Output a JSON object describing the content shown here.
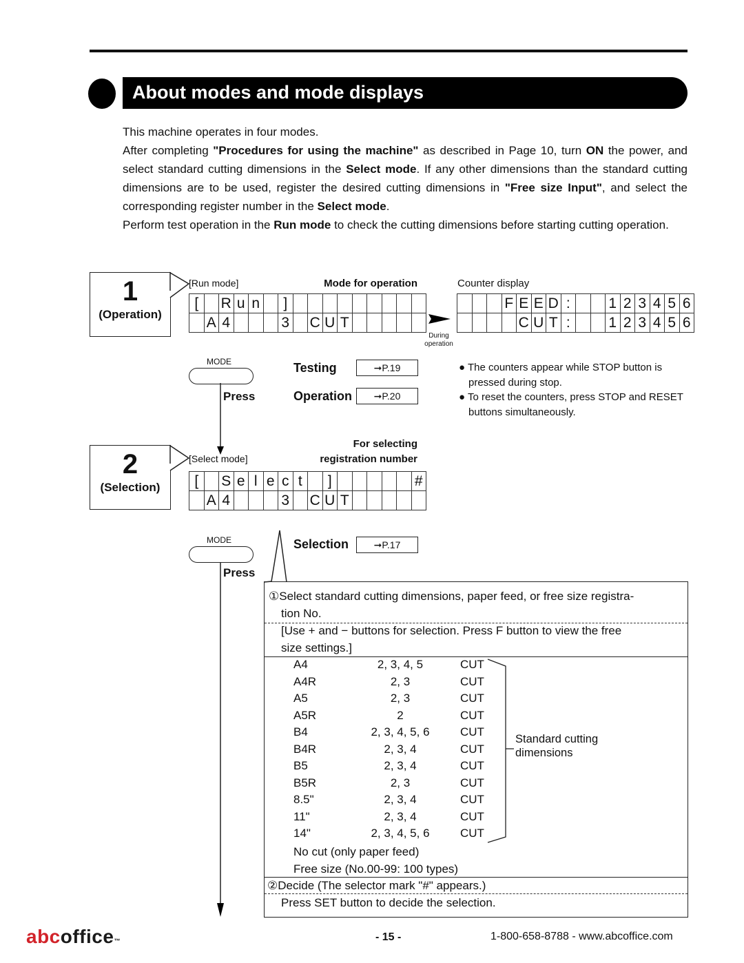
{
  "header": {
    "title": "About modes and mode displays"
  },
  "intro": {
    "p1": "This machine operates in four modes.",
    "p2_a": "After completing ",
    "p2_b": "\"Procedures for using the machine\"",
    "p2_c": " as described in Page 10, turn ",
    "p2_d": "ON",
    "p2_e": " the power, and select standard cutting dimensions in the ",
    "p2_f": "Select mode",
    "p2_g": ". If any other dimensions than the standard cutting dimensions are to be used, register the desired cutting dimensions in ",
    "p2_h": "\"Free size Input\"",
    "p2_i": ", and select the corresponding register number in the ",
    "p2_j": "Select mode",
    "p2_k": ".",
    "p3_a": "Perform test operation in the ",
    "p3_b": "Run mode",
    "p3_c": " to check the cutting dimensions before starting cutting operation."
  },
  "step1": {
    "number": "1",
    "label": "(Operation)",
    "mode_label": "[Run mode]",
    "mode_desc": "Mode for operation",
    "lcd_row1": [
      "[",
      "",
      "R",
      "u",
      "n",
      "",
      "]",
      "",
      "",
      "",
      "",
      "",
      "",
      "",
      "",
      ""
    ],
    "lcd_row2": [
      "",
      "A",
      "4",
      "",
      "",
      "",
      "3",
      "",
      "C",
      "U",
      "T",
      "",
      "",
      "",
      "",
      ""
    ],
    "during_label_1": "During",
    "during_label_2": "operation",
    "counter_title": "Counter display",
    "counter_row1": [
      "",
      "",
      "",
      "F",
      "E",
      "E",
      "D",
      ":",
      "",
      "",
      "1",
      "2",
      "3",
      "4",
      "5",
      "6"
    ],
    "counter_row2": [
      "",
      "",
      "",
      "",
      "C",
      "U",
      "T",
      ":",
      "",
      "",
      "1",
      "2",
      "3",
      "4",
      "5",
      "6"
    ],
    "mode_button_caption": "MODE",
    "press_label": "Press",
    "refs": [
      {
        "label": "Testing",
        "page": "➞P.19"
      },
      {
        "label": "Operation",
        "page": "➞P.20"
      }
    ],
    "notes": [
      "● The counters appear while STOP button is pressed during stop.",
      "● To reset the counters, press STOP and RESET buttons simultaneously."
    ]
  },
  "step2": {
    "number": "2",
    "label": "(Selection)",
    "mode_label": "[Select mode]",
    "mode_desc_1": "For selecting",
    "mode_desc_2": "registration number",
    "lcd_row1": [
      "[",
      "",
      "S",
      "e",
      "l",
      "e",
      "c",
      "t",
      "",
      "]",
      "",
      "",
      "",
      "",
      "",
      "#"
    ],
    "lcd_row2": [
      "",
      "A",
      "4",
      "",
      "",
      "",
      "3",
      "",
      "C",
      "U",
      "T",
      "",
      "",
      "",
      "",
      ""
    ],
    "mode_button_caption": "MODE",
    "press_label": "Press",
    "ref": {
      "label": "Selection",
      "page": "➞P.17"
    }
  },
  "procedure": {
    "step1_line1": "①Select standard cutting dimensions, paper feed, or free size registra-",
    "step1_line2": "tion No.",
    "hint_line1": "[Use  +  and  −  buttons for selection. Press F button to view the free",
    "hint_line2": "size settings.]",
    "sizes": [
      {
        "size": "A4",
        "rolls": "2, 3, 4, 5",
        "mode": "CUT"
      },
      {
        "size": "A4R",
        "rolls": "2, 3",
        "mode": "CUT"
      },
      {
        "size": "A5",
        "rolls": "2, 3",
        "mode": "CUT"
      },
      {
        "size": "A5R",
        "rolls": "2",
        "mode": "CUT"
      },
      {
        "size": "B4",
        "rolls": "2, 3, 4, 5, 6",
        "mode": "CUT"
      },
      {
        "size": "B4R",
        "rolls": "2, 3, 4",
        "mode": "CUT"
      },
      {
        "size": "B5",
        "rolls": "2, 3, 4",
        "mode": "CUT"
      },
      {
        "size": "B5R",
        "rolls": "2, 3",
        "mode": "CUT"
      },
      {
        "size": "8.5\"",
        "rolls": "2, 3, 4",
        "mode": "CUT"
      },
      {
        "size": "11\"",
        "rolls": "2, 3, 4",
        "mode": "CUT"
      },
      {
        "size": "14\"",
        "rolls": "2, 3, 4, 5, 6",
        "mode": "CUT"
      }
    ],
    "bracket_label_1": "Standard cutting",
    "bracket_label_2": "dimensions",
    "no_cut": "No cut (only paper feed)",
    "free_size": "Free size (No.00-99: 100 types)",
    "step2_line": "②Decide (The selector mark \"#\" appears.)",
    "step2_hint": "Press SET button to decide the selection."
  },
  "footer": {
    "logo_abc": "abc",
    "logo_office": "office",
    "logo_tm": "™",
    "page": "- 15 -",
    "contact": "1-800-658-8788  -  www.abcoffice.com",
    "logo_color_red": "#d2232a",
    "logo_color_dark": "#1a1a1a"
  }
}
